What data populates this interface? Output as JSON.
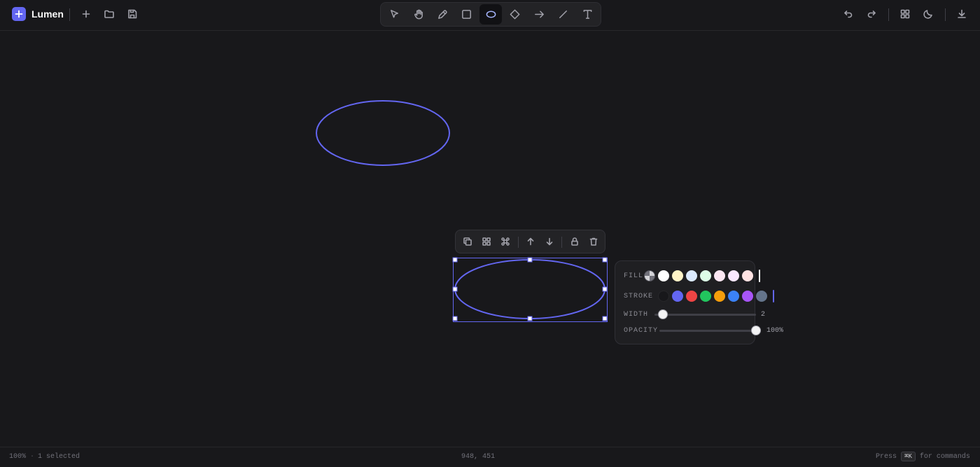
{
  "app": {
    "name": "Lumen",
    "accent": "#6366f1"
  },
  "header": {
    "file_actions": [
      {
        "name": "new-icon",
        "icon": "plus"
      },
      {
        "name": "open-icon",
        "icon": "folder"
      },
      {
        "name": "save-icon",
        "icon": "save"
      }
    ],
    "tools": [
      {
        "id": "select",
        "icon": "cursor-arrow",
        "active": false
      },
      {
        "id": "hand",
        "icon": "hand",
        "active": false
      },
      {
        "id": "pen",
        "icon": "pen",
        "active": false
      },
      {
        "id": "rectangle",
        "icon": "square",
        "active": false
      },
      {
        "id": "ellipse",
        "icon": "ellipse",
        "active": true
      },
      {
        "id": "diamond",
        "icon": "diamond",
        "active": false
      },
      {
        "id": "arrow",
        "icon": "arrow-right",
        "active": false
      },
      {
        "id": "line",
        "icon": "line",
        "active": false
      },
      {
        "id": "text",
        "icon": "text-T",
        "active": false
      }
    ],
    "right_actions": [
      "undo-icon",
      "redo-icon",
      "grid-icon",
      "theme-moon-icon",
      "export-download-icon"
    ]
  },
  "canvas": {
    "shapes": [
      {
        "type": "ellipse",
        "stroke": "#6366f1",
        "selected": false
      },
      {
        "type": "ellipse",
        "stroke": "#6366f1",
        "selected": true
      }
    ]
  },
  "selection_toolbar": {
    "actions": [
      "duplicate-icon",
      "group-icon",
      "command-icon",
      "bring-forward-icon",
      "send-backward-icon",
      "lock-icon",
      "delete-icon"
    ]
  },
  "style_panel": {
    "fill": {
      "label": "FILL",
      "swatches": [
        "transparent",
        "#ffffff",
        "#fef3c7",
        "#dbeafe",
        "#dcfce7",
        "#fce7f3",
        "#fae8ff",
        "#fee2e2"
      ],
      "current": "#ffffff"
    },
    "stroke": {
      "label": "STROKE",
      "swatches": [
        "#18181b",
        "#6366f1",
        "#ef4444",
        "#22c55e",
        "#f59e0b",
        "#3b82f6",
        "#a855f7",
        "#64748b"
      ],
      "current": "#6366f1"
    },
    "width": {
      "label": "WIDTH",
      "value": "2",
      "fraction": 0.05
    },
    "opacity": {
      "label": "OPACITY",
      "value": "100%",
      "fraction": 1.0
    }
  },
  "status": {
    "zoom": "100%",
    "separator": "·",
    "selection": "1 selected",
    "cursor": "948, 451",
    "hint_prefix": "Press",
    "hint_key": "⌘K",
    "hint_suffix": "for commands"
  }
}
